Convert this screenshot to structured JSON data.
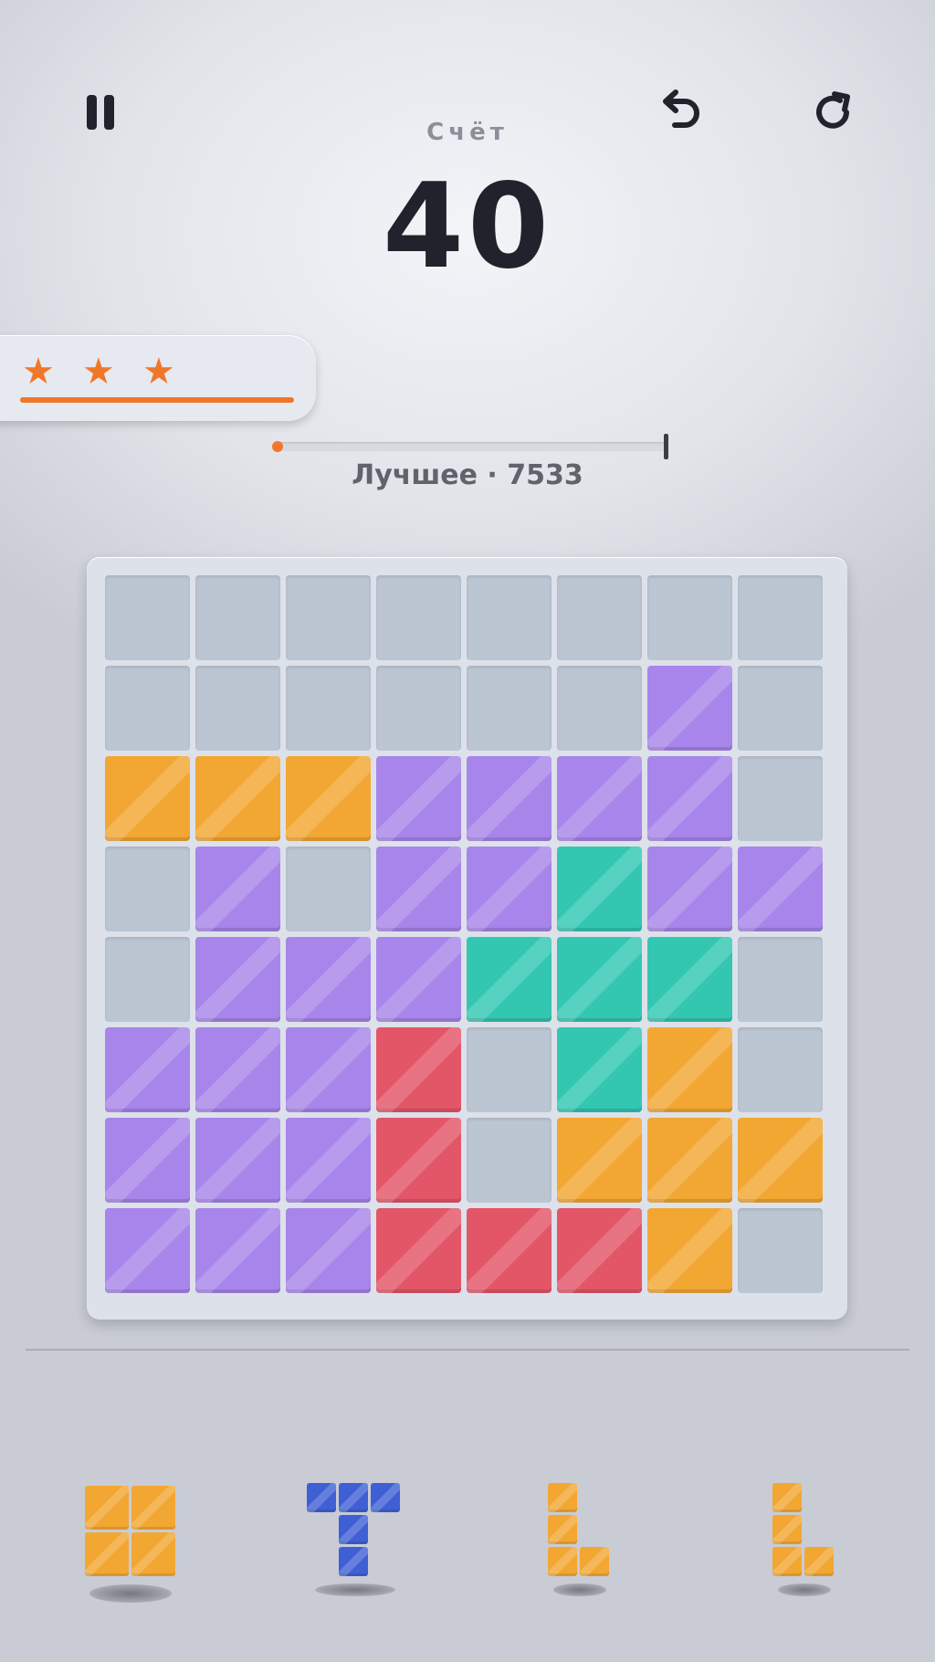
{
  "header": {
    "pause_icon": "pause-icon",
    "undo_icon": "undo-icon",
    "restart_icon": "restart-icon",
    "score_label": "Счёт",
    "score_value": "40"
  },
  "stars": {
    "count": 3,
    "color": "#f0772a"
  },
  "progress": {
    "fraction": 0.005,
    "best_label": "Лучшее · 7533"
  },
  "colors": {
    "orange": "#f2a733",
    "purple": "#a885ea",
    "teal": "#33c7b2",
    "red": "#e35668",
    "blue": "#3f5fd4",
    "empty": "#bcc6d3"
  },
  "board": {
    "rows": [
      [
        ".",
        ".",
        ".",
        ".",
        ".",
        ".",
        ".",
        "."
      ],
      [
        ".",
        ".",
        ".",
        ".",
        ".",
        ".",
        "P",
        "."
      ],
      [
        "O",
        "O",
        "O",
        "P",
        "P",
        "P",
        "P",
        "."
      ],
      [
        ".",
        "P",
        ".",
        "P",
        "P",
        "T",
        "P",
        "P"
      ],
      [
        ".",
        "P",
        "P",
        "P",
        "T",
        "T",
        "T",
        "."
      ],
      [
        "P",
        "P",
        "P",
        "R",
        ".",
        "T",
        "O",
        "."
      ],
      [
        "P",
        "P",
        "P",
        "R",
        ".",
        "O",
        "O",
        "O"
      ],
      [
        "P",
        "P",
        "P",
        "R",
        "R",
        "R",
        "O",
        "."
      ]
    ]
  },
  "tray": {
    "pieces": [
      {
        "name": "square-2x2",
        "color": "orange",
        "cells": [
          [
            0,
            0
          ],
          [
            1,
            0
          ],
          [
            0,
            1
          ],
          [
            1,
            1
          ]
        ]
      },
      {
        "name": "t-piece",
        "color": "blue",
        "cells": [
          [
            0,
            0
          ],
          [
            1,
            0
          ],
          [
            2,
            0
          ],
          [
            1,
            1
          ],
          [
            1,
            2
          ]
        ]
      },
      {
        "name": "l-piece",
        "color": "orange",
        "cells": [
          [
            0,
            0
          ],
          [
            0,
            1
          ],
          [
            0,
            2
          ],
          [
            1,
            2
          ]
        ]
      },
      {
        "name": "l-piece",
        "color": "orange",
        "cells": [
          [
            0,
            0
          ],
          [
            0,
            1
          ],
          [
            0,
            2
          ],
          [
            1,
            2
          ]
        ]
      }
    ]
  }
}
